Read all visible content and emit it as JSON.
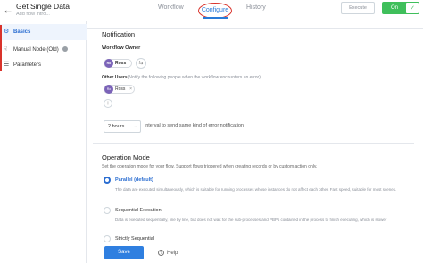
{
  "header": {
    "back_icon": "arrow-left-icon",
    "title": "Get Single Data",
    "subtitle": "Add flow intro...",
    "tabs": [
      {
        "label": "Workflow",
        "active": false
      },
      {
        "label": "Configure",
        "active": true
      },
      {
        "label": "History",
        "active": false
      }
    ],
    "execute_label": "Execute",
    "toggle_label": "On",
    "accent": "#2a7bd8",
    "toggle_color": "#3fbf5b"
  },
  "sidebar": {
    "items": [
      {
        "label": "Basics",
        "icon": "gear-icon",
        "active": true
      },
      {
        "label": "Manual Node (Old)",
        "icon": "hand-icon",
        "active": false
      },
      {
        "label": "Parameters",
        "icon": "list-icon",
        "active": false
      }
    ]
  },
  "notification": {
    "title": "Notification",
    "owner_label": "Workflow Owner",
    "owner": {
      "initials": "Ro",
      "name": "Ross"
    },
    "other_label": "Other Users",
    "other_hint": "(Notify the following people when the workflow encounters an error)",
    "other_user": {
      "initials": "Ro",
      "name": "Ross"
    },
    "interval_value": "2 hours",
    "interval_text": "interval to send same kind of error notification"
  },
  "operation_mode": {
    "title": "Operation Mode",
    "description": "Set the operation mode for your flow. Support flows triggered when creating records or by custom action only.",
    "options": [
      {
        "title": "Parallel (default)",
        "checked": true,
        "desc": "The data are executed simultaneously, which is suitable for running processes whose instances do not affect each other. Fast speed, suitable for most scenes."
      },
      {
        "title": "Sequential Execution",
        "checked": false,
        "desc": "Data is executed sequentially, line by line, but does not wait for the sub-processes and PBPs contained in the process to finish executing, which is slower"
      },
      {
        "title": "Strictly Sequential",
        "checked": false,
        "desc": ""
      }
    ]
  },
  "footer": {
    "save_label": "Save",
    "help_label": "Help"
  }
}
